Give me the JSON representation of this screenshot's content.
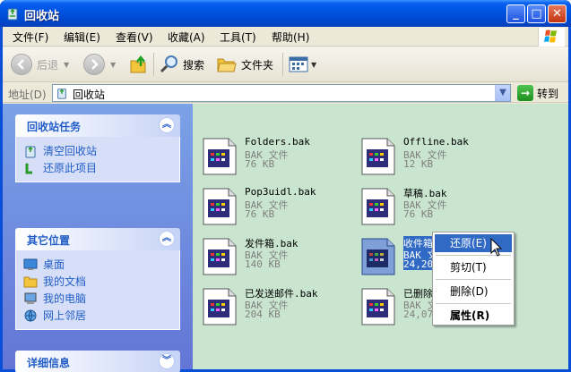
{
  "window": {
    "title": "回收站",
    "controls": [
      "_",
      "□",
      "✕"
    ]
  },
  "menubar": {
    "items": [
      "文件(F)",
      "编辑(E)",
      "查看(V)",
      "收藏(A)",
      "工具(T)",
      "帮助(H)"
    ]
  },
  "toolbar": {
    "back_label": "后退",
    "search_label": "搜索",
    "folders_label": "文件夹"
  },
  "address": {
    "label": "地址(D)",
    "value": "回收站",
    "go_label": "转到"
  },
  "left_pane": {
    "tasks": {
      "title": "回收站任务",
      "items": [
        "清空回收站",
        "还原此项目"
      ]
    },
    "other_places": {
      "title": "其它位置",
      "items": [
        "桌面",
        "我的文档",
        "我的电脑",
        "网上邻居"
      ]
    },
    "details": {
      "title": "详细信息"
    }
  },
  "files": [
    {
      "name": "Folders.bak",
      "type": "BAK 文件",
      "size": "76 KB"
    },
    {
      "name": "Offline.bak",
      "type": "BAK 文件",
      "size": "12 KB"
    },
    {
      "name": "Pop3uidl.bak",
      "type": "BAK 文件",
      "size": "76 KB"
    },
    {
      "name": "草稿.bak",
      "type": "BAK 文件",
      "size": "76 KB"
    },
    {
      "name": "发件箱.bak",
      "type": "BAK 文件",
      "size": "140 KB"
    },
    {
      "name": "收件箱.bak",
      "type": "BAK 文件",
      "size": "24,204",
      "selected": true
    },
    {
      "name": "已发送邮件.bak",
      "type": "BAK 文件",
      "size": "204 KB"
    },
    {
      "name": "已删除",
      "type": "BAK 文件",
      "size": "24,076"
    }
  ],
  "context_menu": {
    "items": [
      "还原(E)",
      "剪切(T)",
      "删除(D)",
      "属性(R)"
    ]
  },
  "colors": {
    "title_bar": "#0054e3",
    "content_bg": "#c9e5cf",
    "selection": "#316ac5",
    "panel_title": "#215dc6"
  }
}
